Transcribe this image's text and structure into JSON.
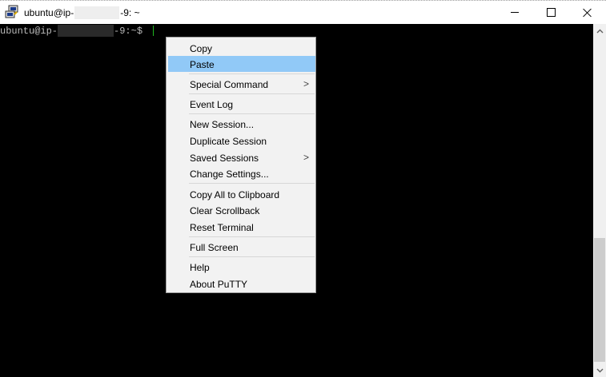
{
  "window": {
    "title_prefix": "ubuntu@ip-",
    "title_suffix": "-9: ~"
  },
  "terminal": {
    "prompt_prefix": "ubuntu@ip-",
    "prompt_suffix": "-9:~$ "
  },
  "menu": {
    "items": [
      {
        "label": "Copy"
      },
      {
        "label": "Paste",
        "highlighted": true
      },
      {
        "label": "Special Command",
        "submenu": true
      },
      {
        "label": "Event Log"
      },
      {
        "label": "New Session..."
      },
      {
        "label": "Duplicate Session"
      },
      {
        "label": "Saved Sessions",
        "submenu": true
      },
      {
        "label": "Change Settings..."
      },
      {
        "label": "Copy All to Clipboard"
      },
      {
        "label": "Clear Scrollback"
      },
      {
        "label": "Reset Terminal"
      },
      {
        "label": "Full Screen"
      },
      {
        "label": "Help"
      },
      {
        "label": "About PuTTY"
      }
    ],
    "submenu_glyph": ">"
  },
  "icons": {
    "app": "putty-icon",
    "minimize": "minimize-icon",
    "maximize": "maximize-icon",
    "close": "close-icon",
    "scroll_up": "chevron-up-icon",
    "scroll_down": "chevron-down-icon"
  },
  "colors": {
    "highlight": "#91c9f7",
    "cursor": "#1fb81f",
    "terminal_bg": "#000000"
  }
}
